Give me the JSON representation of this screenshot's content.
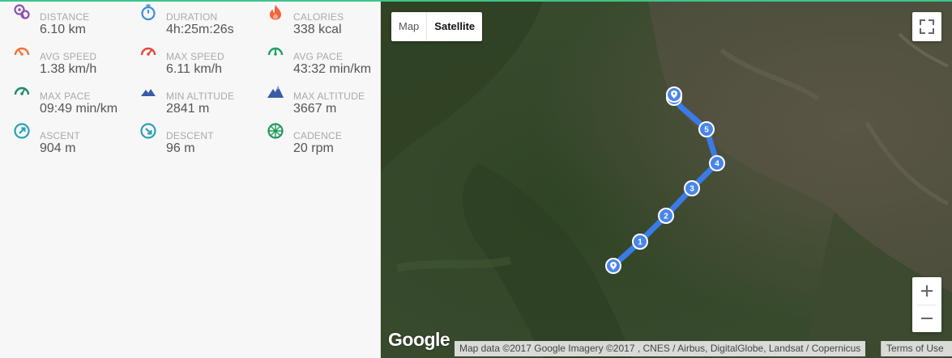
{
  "stats": [
    {
      "key": "distance",
      "label": "DISTANCE",
      "value": "6.10 km",
      "icon": "distance-icon",
      "color": "#8e4fae"
    },
    {
      "key": "duration",
      "label": "DURATION",
      "value": "4h:25m:26s",
      "icon": "stopwatch-icon",
      "color": "#3d8fd8"
    },
    {
      "key": "calories",
      "label": "CALORIES",
      "value": "338 kcal",
      "icon": "flame-icon",
      "color": "#f0643c"
    },
    {
      "key": "avg_speed",
      "label": "AVG SPEED",
      "value": "1.38 km/h",
      "icon": "speedometer-icon",
      "color": "#f07238"
    },
    {
      "key": "max_speed",
      "label": "MAX SPEED",
      "value": "6.11 km/h",
      "icon": "speedometer-icon",
      "color": "#e6473c"
    },
    {
      "key": "avg_pace",
      "label": "AVG PACE",
      "value": "43:32 min/km",
      "icon": "pace-gauge-icon",
      "color": "#1fa266"
    },
    {
      "key": "max_pace",
      "label": "MAX PACE",
      "value": "09:49 min/km",
      "icon": "pace-gauge-icon",
      "color": "#1a8a6a"
    },
    {
      "key": "min_altitude",
      "label": "MIN ALTITUDE",
      "value": "2841 m",
      "icon": "mountain-icon",
      "color": "#3a5ba8"
    },
    {
      "key": "max_altitude",
      "label": "MAX ALTITUDE",
      "value": "3667 m",
      "icon": "mountain-icon",
      "color": "#3a5ba8"
    },
    {
      "key": "ascent",
      "label": "ASCENT",
      "value": "904 m",
      "icon": "ascent-compass-icon",
      "color": "#2aa0b8"
    },
    {
      "key": "descent",
      "label": "DESCENT",
      "value": "96 m",
      "icon": "descent-compass-icon",
      "color": "#2aa0b8"
    },
    {
      "key": "cadence",
      "label": "CADENCE",
      "value": "20 rpm",
      "icon": "cadence-wheel-icon",
      "color": "#1f9a5a"
    }
  ],
  "map": {
    "map_type_labels": {
      "map": "Map",
      "satellite": "Satellite"
    },
    "selected_type": "Satellite",
    "route_color": "#3b7be8",
    "km_markers": [
      "1",
      "2",
      "3",
      "4",
      "5"
    ],
    "logo": "Google",
    "attribution": "Map data ©2017 Google Imagery ©2017 , CNES / Airbus, DigitalGlobe, Landsat / Copernicus",
    "terms": "Terms of Use"
  }
}
